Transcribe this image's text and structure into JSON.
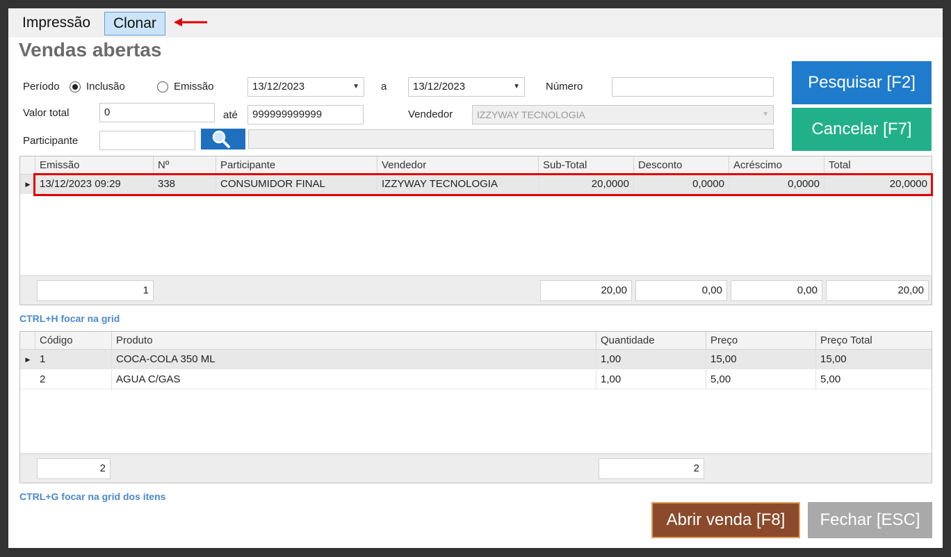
{
  "menu": {
    "items": [
      "Impressão",
      "Clonar"
    ],
    "selected": "Clonar"
  },
  "page_title": "Vendas abertas",
  "filters": {
    "periodo_label": "Período",
    "radio_inclusao": "Inclusão",
    "radio_emissao": "Emissão",
    "selected_radio": "Inclusão",
    "date_from": "13/12/2023",
    "date_sep": "a",
    "date_to": "13/12/2023",
    "numero_label": "Número",
    "numero_value": "",
    "valor_total_label": "Valor total",
    "valor_from": "0",
    "ate_label": "até",
    "valor_to": "999999999999",
    "vendedor_label": "Vendedor",
    "vendedor_value": "IZZYWAY TECNOLOGIA",
    "participante_label": "Participante",
    "participante_code": "",
    "participante_name": ""
  },
  "buttons": {
    "pesquisar": "Pesquisar [F2]",
    "cancelar": "Cancelar [F7]",
    "abrir_venda": "Abrir venda [F8]",
    "fechar": "Fechar [ESC]"
  },
  "sales_grid": {
    "columns": [
      "Emissão",
      "Nº",
      "Participante",
      "Vendedor",
      "Sub-Total",
      "Desconto",
      "Acréscimo",
      "Total"
    ],
    "rows": [
      [
        "13/12/2023 09:29",
        "338",
        "CONSUMIDOR FINAL",
        "IZZYWAY TECNOLOGIA",
        "20,0000",
        "0,0000",
        "0,0000",
        "20,0000"
      ]
    ],
    "footer": {
      "count": "1",
      "subtotal": "20,00",
      "desconto": "0,00",
      "acrescimo": "0,00",
      "total": "20,00"
    }
  },
  "hint_grid": "CTRL+H focar na grid",
  "items_grid": {
    "columns": [
      "Código",
      "Produto",
      "Quantidade",
      "Preço",
      "Preço Total"
    ],
    "rows": [
      [
        "1",
        "COCA-COLA 350 ML",
        "1,00",
        "15,00",
        "15,00"
      ],
      [
        "2",
        "AGUA C/GAS",
        "1,00",
        "5,00",
        "5,00"
      ]
    ],
    "footer": {
      "count": "2",
      "quantidade": "2"
    }
  },
  "hint_items": "CTRL+G focar na grid dos itens",
  "colors": {
    "pesquisar": "#1f7ccc",
    "cancelar": "#22b08a",
    "abrir_venda": "#8b4a2b",
    "fechar": "#a9a9a9",
    "highlight": "#e00000"
  }
}
